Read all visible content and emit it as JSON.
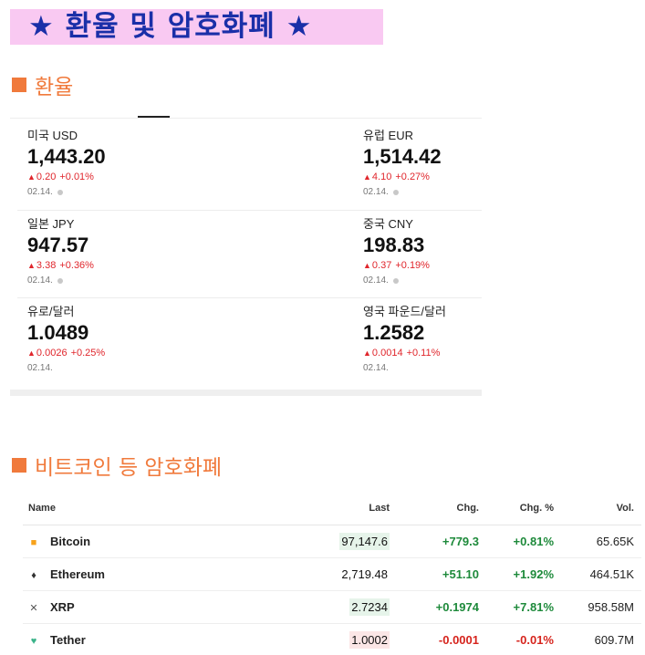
{
  "banner": {
    "text": "★ 환율 및 암호화폐 ★"
  },
  "fx_section": {
    "title": "환율"
  },
  "fx": [
    {
      "name": "미국 USD",
      "value": "1,443.20",
      "change": "0.20",
      "pct": "+0.01%",
      "date": "02.14.",
      "live": true
    },
    {
      "name": "유럽 EUR",
      "value": "1,514.42",
      "change": "4.10",
      "pct": "+0.27%",
      "date": "02.14.",
      "live": true
    },
    {
      "name": "일본 JPY",
      "value": "947.57",
      "change": "3.38",
      "pct": "+0.36%",
      "date": "02.14.",
      "live": true
    },
    {
      "name": "중국 CNY",
      "value": "198.83",
      "change": "0.37",
      "pct": "+0.19%",
      "date": "02.14.",
      "live": true
    },
    {
      "name": "유로/달러",
      "value": "1.0489",
      "change": "0.0026",
      "pct": "+0.25%",
      "date": "02.14.",
      "live": false
    },
    {
      "name": "영국 파운드/달러",
      "value": "1.2582",
      "change": "0.0014",
      "pct": "+0.11%",
      "date": "02.14.",
      "live": false
    }
  ],
  "crypto_section": {
    "title": "비트코인 등 암호화폐"
  },
  "crypto_table": {
    "headers": [
      "Name",
      "Last",
      "Chg.",
      "Chg. %",
      "Vol."
    ],
    "rows": [
      {
        "name": "Bitcoin",
        "icon": "bitcoin-icon",
        "last": "97,147.6",
        "chg": "+779.3",
        "pct": "+0.81%",
        "vol": "65.65K",
        "dir": "up",
        "highlight": true
      },
      {
        "name": "Ethereum",
        "icon": "ethereum-icon",
        "last": "2,719.48",
        "chg": "+51.10",
        "pct": "+1.92%",
        "vol": "464.51K",
        "dir": "up",
        "highlight": false
      },
      {
        "name": "XRP",
        "icon": "xrp-icon",
        "last": "2.7234",
        "chg": "+0.1974",
        "pct": "+7.81%",
        "vol": "958.58M",
        "dir": "up",
        "highlight": true
      },
      {
        "name": "Tether",
        "icon": "tether-icon",
        "last": "1.0002",
        "chg": "-0.0001",
        "pct": "-0.01%",
        "vol": "609.7M",
        "dir": "down",
        "highlight": true
      }
    ]
  },
  "colors": {
    "banner_bg": "#f9c9f2",
    "banner_text": "#1a2fa8",
    "section_title": "#f07a3c",
    "fx_up": "#e0262c",
    "positive": "#1e8a3b",
    "negative": "#d6241d",
    "highlight_up": "#e6f4ea",
    "highlight_down": "#fbe6e6"
  }
}
